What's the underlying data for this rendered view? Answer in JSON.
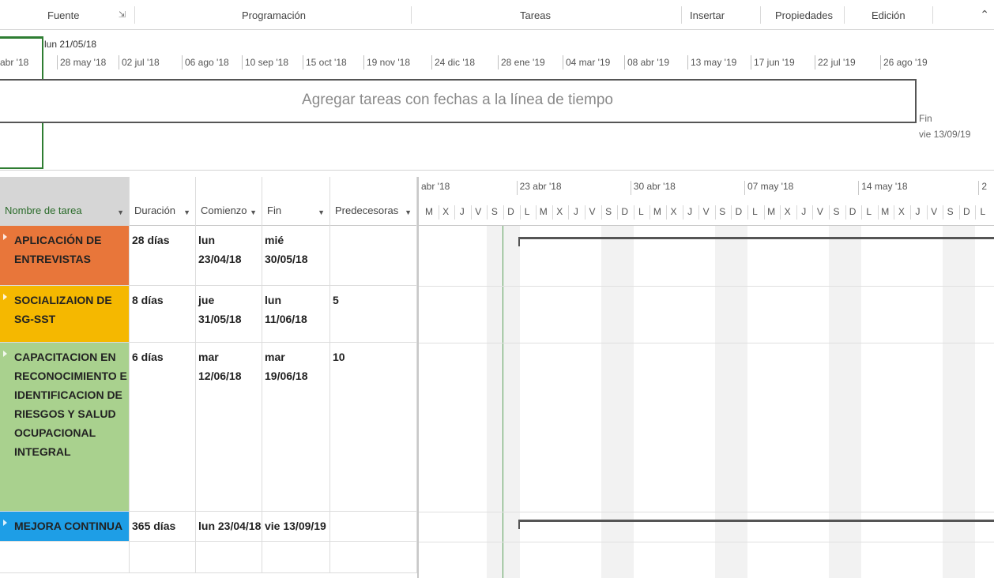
{
  "ribbon": {
    "groups": [
      "Fuente",
      "Programación",
      "Tareas",
      "Insertar",
      "Propiedades",
      "Edición"
    ],
    "launcher_icon": "dialog-launcher-icon",
    "collapse_icon": "chevron-up-icon"
  },
  "timeline": {
    "today_label": "lun 21/05/18",
    "dates": [
      "abr '18",
      "28 may '18",
      "02 jul '18",
      "06 ago '18",
      "10 sep '18",
      "15 oct '18",
      "19 nov '18",
      "24 dic '18",
      "28 ene '19",
      "04 mar '19",
      "08 abr '19",
      "13 may '19",
      "17 jun '19",
      "22 jul '19",
      "26 ago '19"
    ],
    "placeholder": "Agregar tareas con fechas a la línea de tiempo",
    "finish_label": "Fin",
    "finish_date": "vie 13/09/19"
  },
  "sheet": {
    "headers": {
      "name": "Nombre de tarea",
      "duration": "Duración",
      "start": "Comienzo",
      "finish": "Fin",
      "predecessors": "Predecesoras"
    },
    "rows": [
      {
        "name_lines": [
          "APLICACIÓN DE",
          "ENTREVISTAS"
        ],
        "duration": "28 días",
        "start_lines": [
          "lun",
          "23/04/18"
        ],
        "finish_lines": [
          "mié",
          "30/05/18"
        ],
        "predecessors": "",
        "color": "#e8763a"
      },
      {
        "name_lines": [
          "SOCIALIZAION DE",
          "SG-SST"
        ],
        "duration": "8 días",
        "start_lines": [
          "jue",
          "31/05/18"
        ],
        "finish_lines": [
          "lun",
          "11/06/18"
        ],
        "predecessors": "5",
        "color": "#f5b800"
      },
      {
        "name_lines": [
          "CAPACITACION EN",
          "RECONOCIMIENTO E",
          "IDENTIFICACION DE",
          "RIESGOS Y SALUD",
          "OCUPACIONAL",
          "INTEGRAL"
        ],
        "duration": "6 días",
        "start_lines": [
          "mar",
          "12/06/18"
        ],
        "finish_lines": [
          "mar",
          "19/06/18"
        ],
        "predecessors": "10",
        "color": "#a9d18e"
      },
      {
        "name_lines": [
          "MEJORA CONTINUA"
        ],
        "duration": "365 días",
        "start_lines": [
          "lun 23/04/18"
        ],
        "finish_lines": [
          "vie 13/09/19"
        ],
        "predecessors": "",
        "color": "#1e9ee6"
      }
    ]
  },
  "gantt": {
    "weeks": [
      "abr '18",
      "23 abr '18",
      "30 abr '18",
      "07 may '18",
      "14 may '18",
      "2"
    ],
    "day_letters": [
      "M",
      "X",
      "J",
      "V",
      "S",
      "D",
      "L",
      "M",
      "X",
      "J",
      "V",
      "S",
      "D",
      "L",
      "M",
      "X",
      "J",
      "V",
      "S",
      "D",
      "L",
      "M",
      "X",
      "J",
      "V",
      "S",
      "D",
      "L",
      "M",
      "X",
      "J",
      "V",
      "S",
      "D",
      "L"
    ]
  }
}
